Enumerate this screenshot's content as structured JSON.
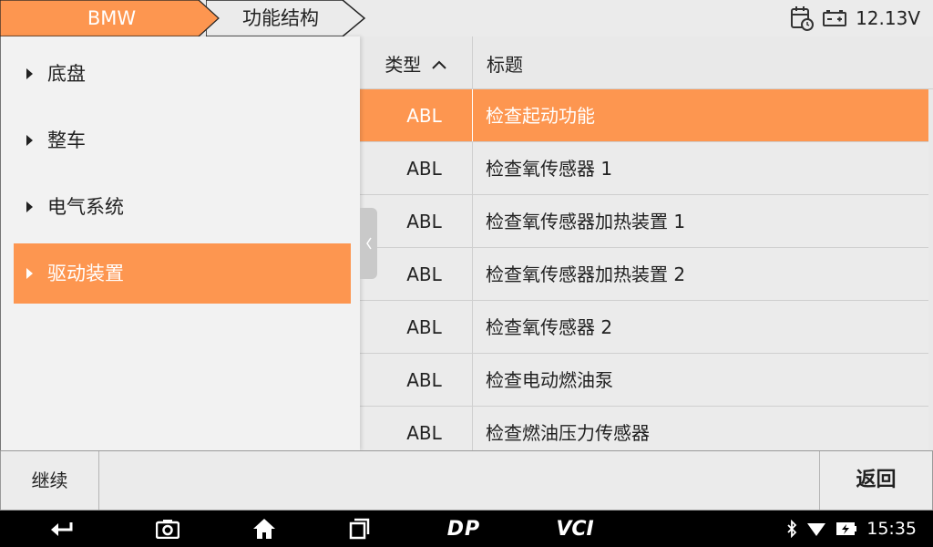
{
  "header": {
    "brand": "BMW",
    "breadcrumb": "功能结构",
    "battery_voltage": "12.13V"
  },
  "sidebar": {
    "items": [
      {
        "label": "底盘",
        "selected": false
      },
      {
        "label": "整车",
        "selected": false
      },
      {
        "label": "电气系统",
        "selected": false
      },
      {
        "label": "驱动装置",
        "selected": true
      }
    ]
  },
  "table": {
    "columns": {
      "type": "类型",
      "title": "标题"
    },
    "rows": [
      {
        "type": "ABL",
        "title": "检查起动功能",
        "selected": true
      },
      {
        "type": "ABL",
        "title": "检查氧传感器 1",
        "selected": false
      },
      {
        "type": "ABL",
        "title": "检查氧传感器加热装置 1",
        "selected": false
      },
      {
        "type": "ABL",
        "title": "检查氧传感器加热装置 2",
        "selected": false
      },
      {
        "type": "ABL",
        "title": "检查氧传感器 2",
        "selected": false
      },
      {
        "type": "ABL",
        "title": "检查电动燃油泵",
        "selected": false
      },
      {
        "type": "ABL",
        "title": "检查燃油压力传感器",
        "selected": false
      }
    ]
  },
  "actions": {
    "continue": "继续",
    "back": "返回"
  },
  "system": {
    "time": "15:35",
    "dp_label": "DP",
    "vci_label": "VCI"
  },
  "colors": {
    "accent": "#fd9650",
    "background": "#e9e9e9"
  }
}
